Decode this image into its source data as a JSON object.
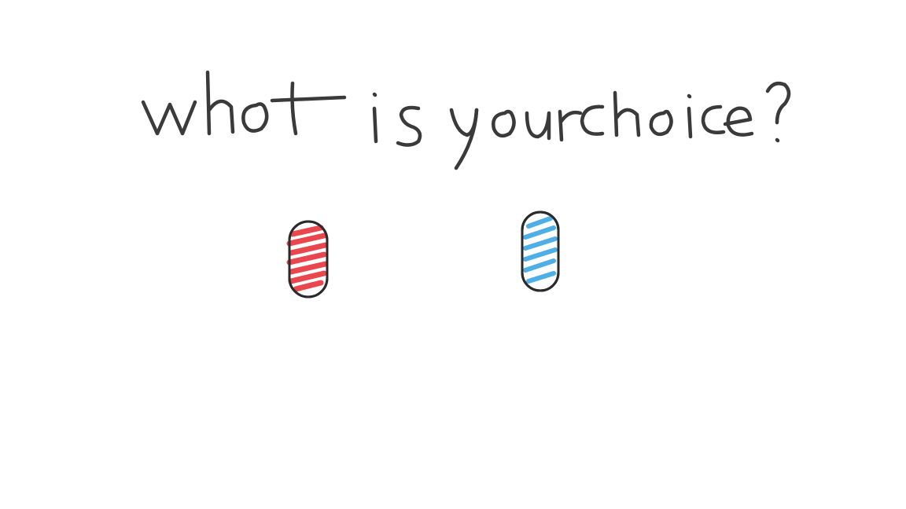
{
  "question": {
    "text": "what is your choice ?"
  },
  "choices": [
    {
      "name": "red-pill",
      "color": "#e8323a"
    },
    {
      "name": "blue-pill",
      "color": "#3aa6e6"
    }
  ],
  "colors": {
    "ink": "#2a2a2a",
    "background": "#ffffff"
  }
}
